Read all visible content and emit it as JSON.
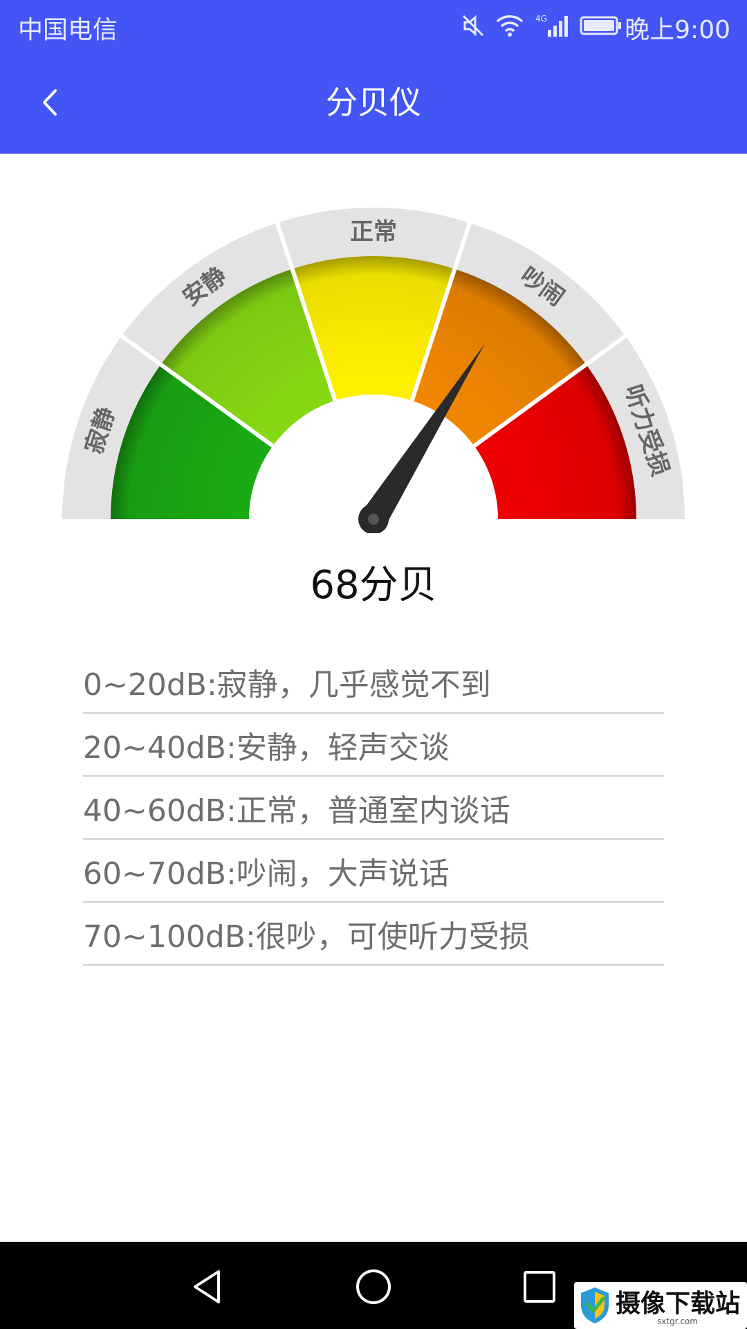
{
  "status_bar": {
    "carrier": "中国电信",
    "network": "4G",
    "time": "晚上9:00"
  },
  "header": {
    "title": "分贝仪",
    "back_icon": "chevron-left-icon"
  },
  "gauge": {
    "min_db": 0,
    "max_db": 100,
    "current_db": 68,
    "segments": [
      {
        "label": "寂静",
        "color": "#1aaa14"
      },
      {
        "label": "安静",
        "color": "#86d814"
      },
      {
        "label": "正常",
        "color": "#fff000"
      },
      {
        "label": "吵闹",
        "color": "#f08600"
      },
      {
        "label": "听力受损",
        "color": "#ee0000"
      }
    ]
  },
  "reading": {
    "text": "68分贝"
  },
  "legend": [
    "0~20dB:寂静，几乎感觉不到",
    "20~40dB:安静，轻声交谈",
    "40~60dB:正常，普通室内谈话",
    "60~70dB:吵闹，大声说话",
    "70~100dB:很吵，可使听力受损"
  ],
  "nav": {
    "back_icon": "triangle-back-icon",
    "home_icon": "circle-home-icon",
    "recents_icon": "square-recents-icon"
  },
  "watermark": {
    "text": "摄像下载站",
    "sub": "sxtgr.com"
  },
  "colors": {
    "accent": "#4455f5",
    "nav_bg": "#000000"
  }
}
